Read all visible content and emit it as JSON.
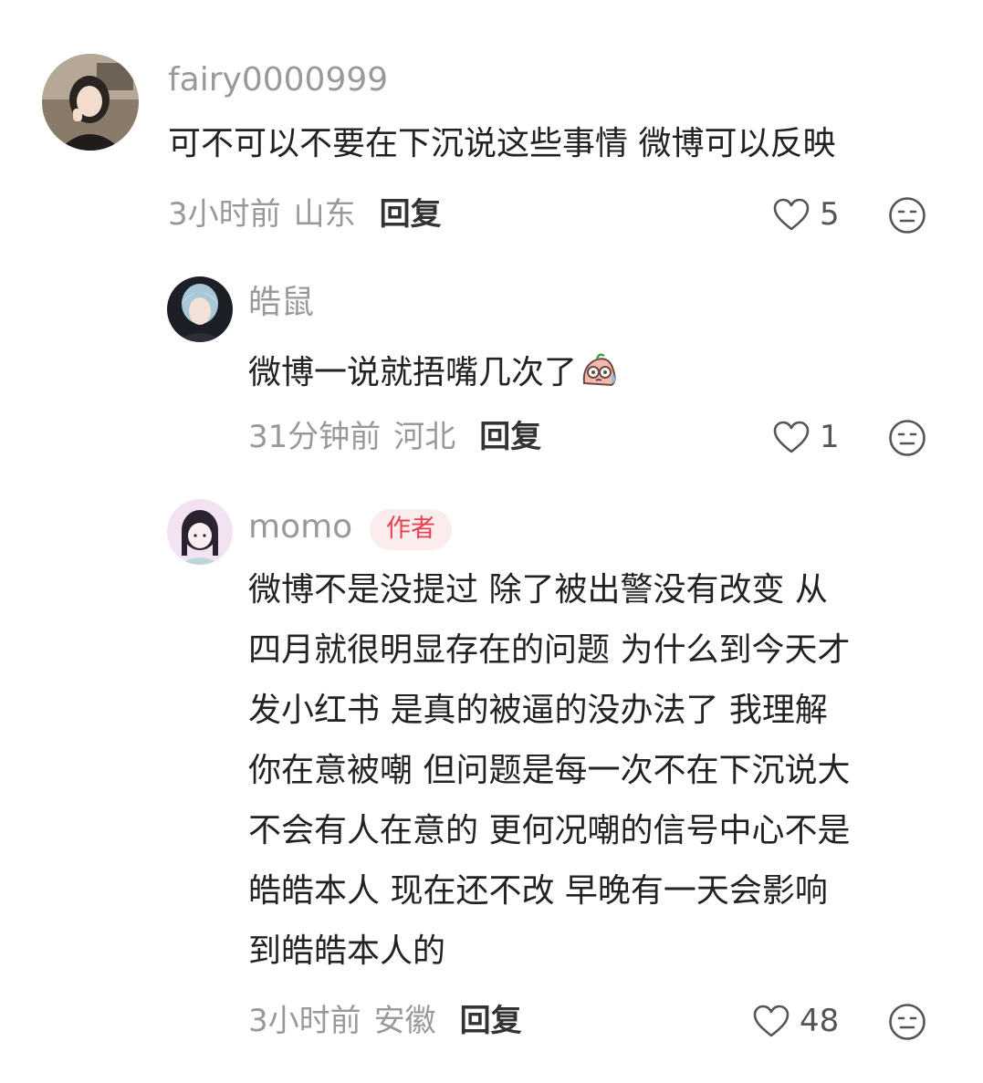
{
  "comments": [
    {
      "username": "fairy0000999",
      "text": "可不可以不要在下沉说这些事情 微博可以反映",
      "time": "3小时前",
      "location": "山东",
      "reply_label": "回复",
      "likes": "5"
    },
    {
      "username": "皓鼠",
      "text": "微博一说就捂嘴几次了",
      "emoji": "sweat-face-emoji",
      "time": "31分钟前",
      "location": "河北",
      "reply_label": "回复",
      "likes": "1"
    },
    {
      "username": "momo",
      "badge": "作者",
      "text": "微博不是没提过 除了被出警没有改变 从\n四月就很明显存在的问题 为什么到今天才\n发小红书 是真的被逼的没办法了 我理解\n你在意被嘲 但问题是每一次不在下沉说大\n不会有人在意的 更何况嘲的信号中心不是\n皓皓本人 现在还不改 早晚有一天会影响\n到皓皓本人的",
      "time": "3小时前",
      "location": "安徽",
      "reply_label": "回复",
      "likes": "48"
    }
  ],
  "icons": {
    "like": "heart-outline-icon",
    "react": "emoji-face-icon"
  },
  "colors": {
    "muted": "#999999",
    "text": "#222222",
    "badge_bg": "#fdecee",
    "badge_text": "#e8404f"
  }
}
